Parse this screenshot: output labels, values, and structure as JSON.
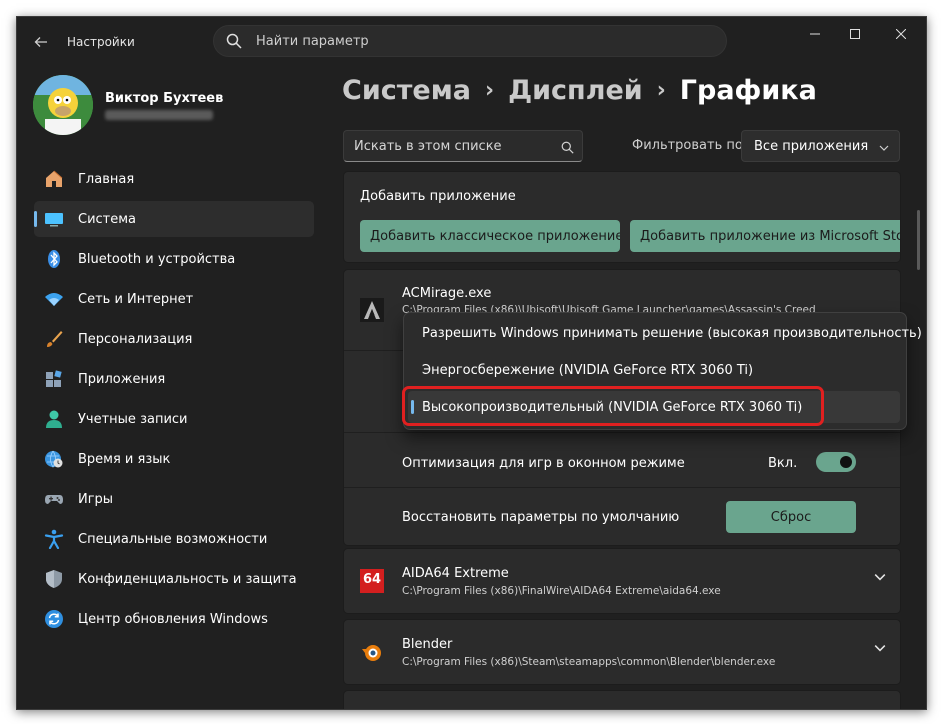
{
  "window": {
    "title": "Настройки",
    "search_placeholder": "Найти параметр"
  },
  "user": {
    "name": "Виктор Бухтеев"
  },
  "nav": [
    {
      "label": "Главная",
      "icon": "home-icon"
    },
    {
      "label": "Система",
      "icon": "system-display-icon",
      "active": true
    },
    {
      "label": "Bluetooth и устройства",
      "icon": "bluetooth-icon"
    },
    {
      "label": "Сеть и Интернет",
      "icon": "wifi-icon"
    },
    {
      "label": "Персонализация",
      "icon": "brush-icon"
    },
    {
      "label": "Приложения",
      "icon": "apps-icon"
    },
    {
      "label": "Учетные записи",
      "icon": "account-icon"
    },
    {
      "label": "Время и язык",
      "icon": "globe-clock-icon"
    },
    {
      "label": "Игры",
      "icon": "gamepad-icon"
    },
    {
      "label": "Специальные возможности",
      "icon": "accessibility-icon"
    },
    {
      "label": "Конфиденциальность и защита",
      "icon": "shield-icon"
    },
    {
      "label": "Центр обновления Windows",
      "icon": "update-icon"
    }
  ],
  "breadcrumb": {
    "item1": "Система",
    "item2": "Дисплей",
    "current": "Графика"
  },
  "list_search_placeholder": "Искать в этом списке",
  "filter": {
    "label": "Фильтровать по:",
    "value": "Все приложения"
  },
  "add_app": {
    "title": "Добавить приложение",
    "classic_button": "Добавить классическое приложение",
    "store_button": "Добавить приложение из Microsoft Store"
  },
  "apps": [
    {
      "name": "ACMirage.exe",
      "path": "C:\\Program Files (x86)\\Ubisoft\\Ubisoft Game Launcher\\games\\Assassin's Creed",
      "icon": "acmirage-icon",
      "expanded": true,
      "game_optimization_label": "Оптимизация для игр в оконном режиме",
      "toggle_state": "Вкл.",
      "reset_label": "Восстановить параметры по умолчанию",
      "reset_button": "Сброс"
    },
    {
      "name": "AIDA64 Extreme",
      "path": "C:\\Program Files (x86)\\FinalWire\\AIDA64 Extreme\\aida64.exe",
      "icon": "aida64-icon",
      "icon_text": "64"
    },
    {
      "name": "Blender",
      "path": "C:\\Program Files (x86)\\Steam\\steamapps\\common\\Blender\\blender.exe",
      "icon": "blender-icon"
    }
  ],
  "gpu_dropdown": {
    "options": [
      "Разрешить Windows принимать решение (высокая производительность)",
      "Энергосбережение (NVIDIA GeForce RTX 3060 Ti)",
      "Высокопроизводительный (NVIDIA GeForce RTX 3060 Ti)"
    ],
    "selected_index": 2
  },
  "colors": {
    "accent": "#76b9ed",
    "button_green": "#6aa58e",
    "highlight_red": "#e02020",
    "background": "#202020",
    "card": "#2b2b2b"
  }
}
